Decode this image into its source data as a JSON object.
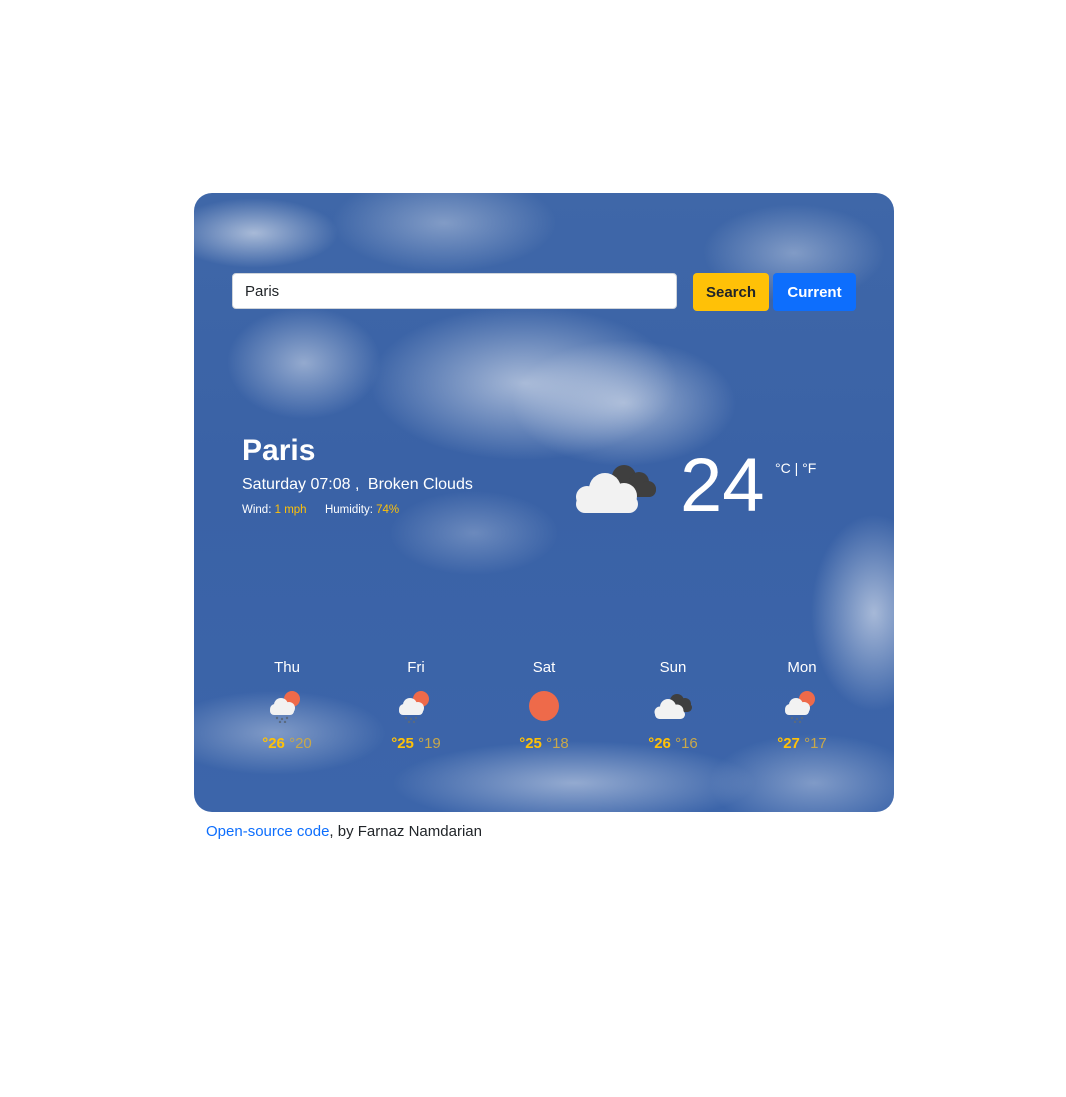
{
  "search": {
    "value": "Paris",
    "search_label": "Search",
    "current_label": "Current"
  },
  "current": {
    "city": "Paris",
    "day_time": "Saturday 07:08",
    "separator": ",",
    "description": "Broken Clouds",
    "wind_label": "Wind:",
    "wind_value": "1 mph",
    "humidity_label": "Humidity:",
    "humidity_value": "74%",
    "temperature": "24",
    "unit_c": "°C",
    "unit_sep": "|",
    "unit_f": "°F",
    "icon": "broken-clouds-icon"
  },
  "forecast": [
    {
      "day": "Thu",
      "max": "°26",
      "min": "°20",
      "icon": "rain-sun-cloud-icon"
    },
    {
      "day": "Fri",
      "max": "°25",
      "min": "°19",
      "icon": "rain-sun-cloud-icon"
    },
    {
      "day": "Sat",
      "max": "°25",
      "min": "°18",
      "icon": "sun-icon"
    },
    {
      "day": "Sun",
      "max": "°26",
      "min": "°16",
      "icon": "broken-clouds-icon"
    },
    {
      "day": "Mon",
      "max": "°27",
      "min": "°17",
      "icon": "rain-sun-cloud-icon"
    }
  ],
  "footer": {
    "link_text": "Open-source code",
    "rest_text": ", by Farnaz Namdarian"
  },
  "colors": {
    "accent_yellow": "#ffc107",
    "accent_blue": "#0d6efd",
    "sun": "#ee6a4a",
    "sky": "#3c65aa"
  }
}
